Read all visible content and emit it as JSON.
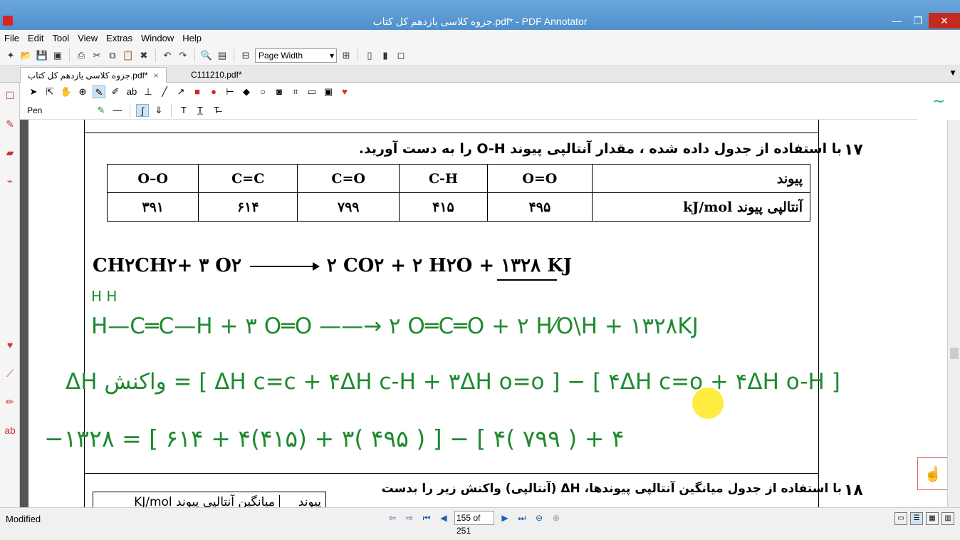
{
  "window": {
    "title": "جزوه کلاسی یازدهم کل کتاب.pdf* - PDF Annotator",
    "minimize": "—",
    "maximize": "❐",
    "close": "✕"
  },
  "menu": [
    "File",
    "Edit",
    "Tool",
    "View",
    "Extras",
    "Window",
    "Help"
  ],
  "toolbar": {
    "zoom_value": "Page Width"
  },
  "tabs": [
    {
      "label": "جزوه کلاسی یازدهم کل کتاب.pdf*",
      "close": "×"
    },
    {
      "label": "C111210.pdf*",
      "close": ""
    }
  ],
  "tool_panel": {
    "pen_label": "Pen",
    "preview_glyph": "∼"
  },
  "document": {
    "q17_number": "۱۷",
    "q17_text": "با استفاده از جدول داده شده ، مقدار آنتالپی پیوند O-H را به دست آورید.",
    "table": {
      "row1": [
        "O–O",
        "C=C",
        "C=O",
        "C-H",
        "O=O",
        "پیوند"
      ],
      "row2": [
        "۳۹۱",
        "۶۱۴",
        "۷۹۹",
        "۴۱۵",
        "۴۹۵",
        "آنتالپی پیوند   kJ/mol"
      ]
    },
    "reaction_left": "CH۲CH۲+ ۳ O۲",
    "reaction_right": "۲ CO۲    + ۲ H۲O + ۱۳۲۸ KJ",
    "hw_h_top": "H         H",
    "hw_line1": "H—C═C—H   +  ۳ O═O ——→ ۲ O═C═O + ۲ H⁄O\\H  + ۱۳۲۸KJ",
    "hw_line2": "ΔH واکنش = [ ΔH c=c + ۴ΔH c-H + ۳ΔH o=o ] − [ ۴ΔH c=o + ۴ΔH o-H ]",
    "hw_line3": "−۱۳۲۸ = [ ۶۱۴ + ۴(۴۱۵) + ۳( ۴۹۵ ) ] − [ ۴( ۷۹۹ ) + ۴",
    "q18_number": "۱۸",
    "q18_text": "با استفاده از جدول میانگین آنتالپی پیوندها، ΔH (آنتالپی) واکنش زیر را بدست",
    "q18_table_right": "پیوند",
    "q18_table_mid": "میانگین آنتالپی پیوند KJ/mol"
  },
  "status": {
    "modified": "Modified",
    "page_indicator": "155 of 251"
  }
}
